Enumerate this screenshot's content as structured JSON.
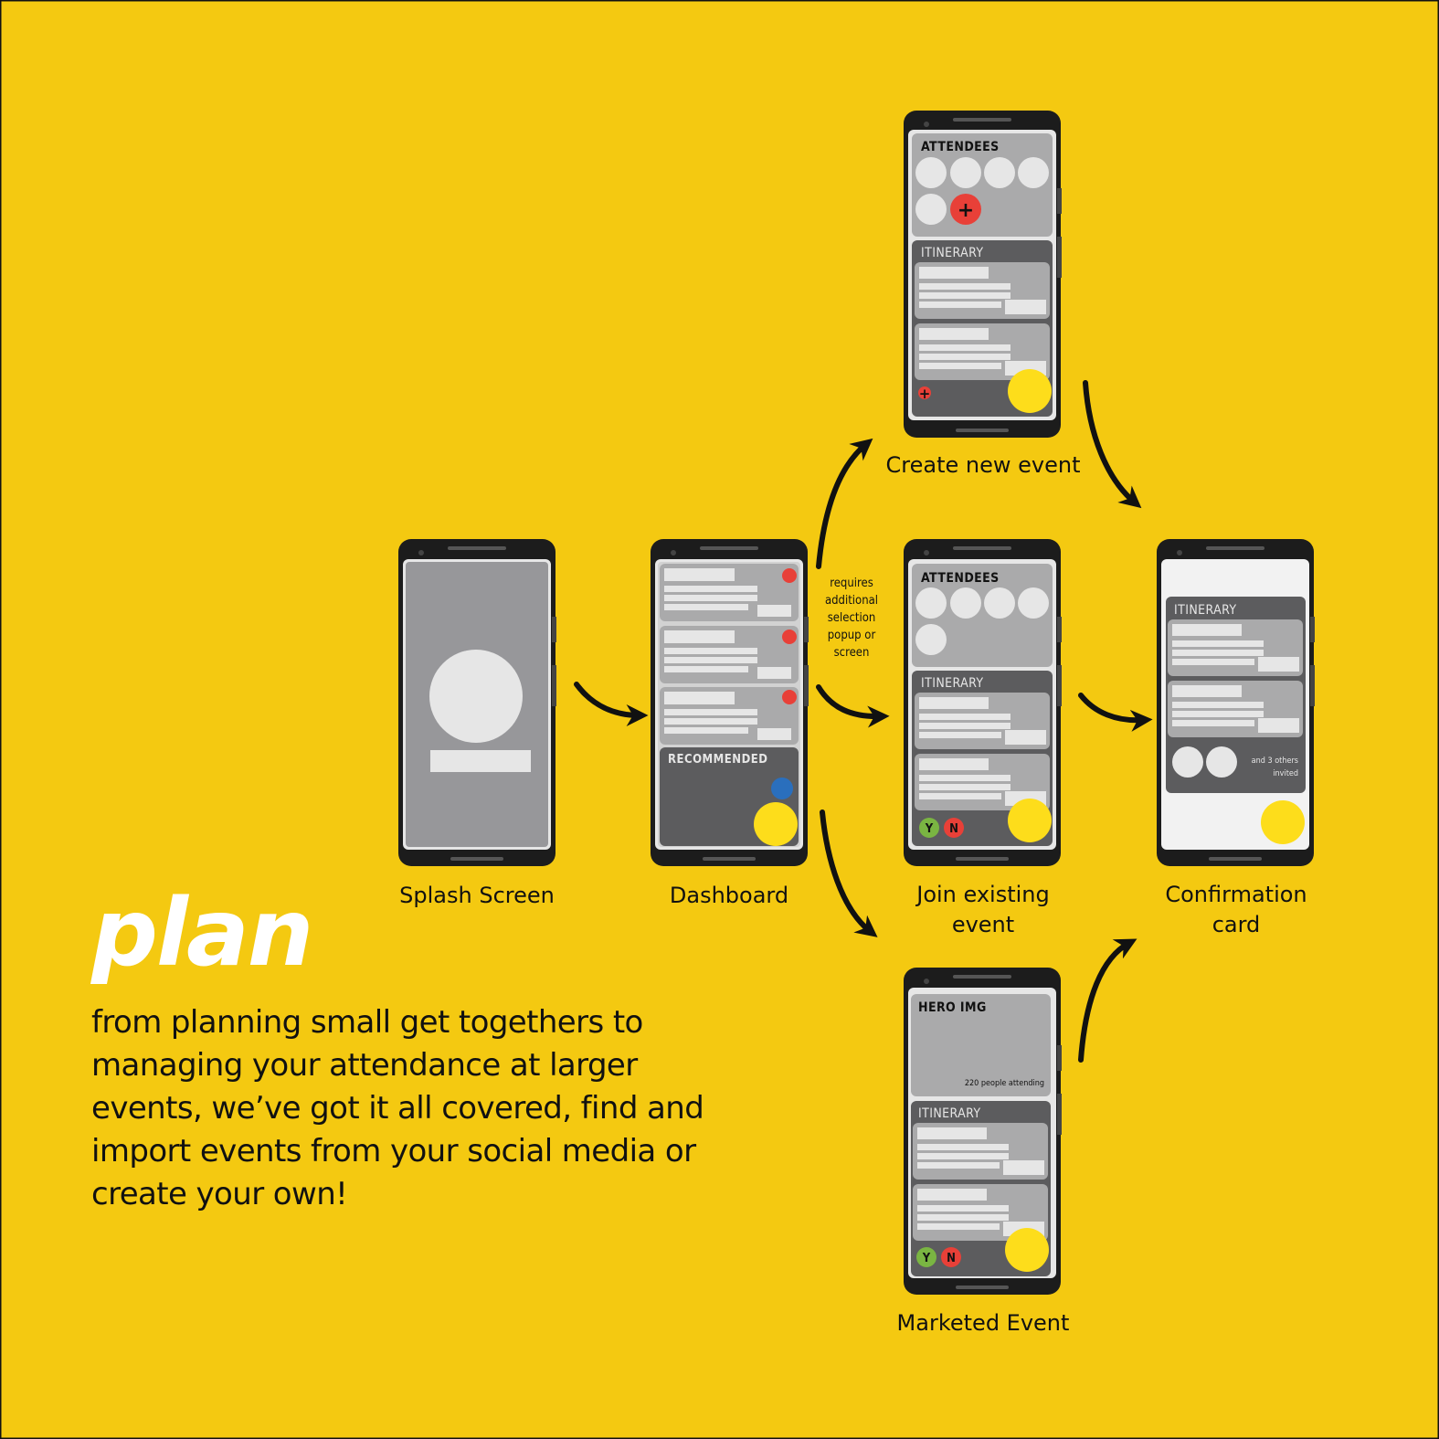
{
  "colors": {
    "background": "#f4c911",
    "phone_body": "#1c1c1c",
    "light_card": "#aaaaab",
    "dark_card": "#5c5c5e",
    "placeholder": "#e6e6e6",
    "accent_yellow": "#fddd1b",
    "accent_red": "#e84038",
    "accent_blue": "#2a6fbd",
    "accent_green": "#7ab542"
  },
  "screens": {
    "splash": {
      "label": "Splash Screen"
    },
    "dashboard": {
      "label": "Dashboard",
      "recommended": "RECOMMENDED"
    },
    "create": {
      "label": "Create new event",
      "attendees": "ATTENDEES",
      "itinerary": "ITINERARY",
      "plus": "+"
    },
    "join": {
      "label_line1": "Join existing",
      "label_line2": "event",
      "attendees": "ATTENDEES",
      "itinerary": "ITINERARY",
      "yes": "Y",
      "no": "N"
    },
    "confirm": {
      "label_line1": "Confirmation",
      "label_line2": "card",
      "itinerary": "ITINERARY",
      "invited_line1": "and 3 others",
      "invited_line2": "invited"
    },
    "marketed": {
      "label": "Marketed Event",
      "hero": "HERO IMG",
      "attending": "220 people attending",
      "itinerary": "ITINERARY",
      "yes": "Y",
      "no": "N"
    }
  },
  "note": [
    "requires",
    "additional",
    "selection",
    "popup or",
    "screen"
  ],
  "plan": {
    "title": "plan",
    "body": "from planning small get togethers to managing your attendance at larger events, we’ve got it all covered, find and import events from your social media or create your own!"
  }
}
